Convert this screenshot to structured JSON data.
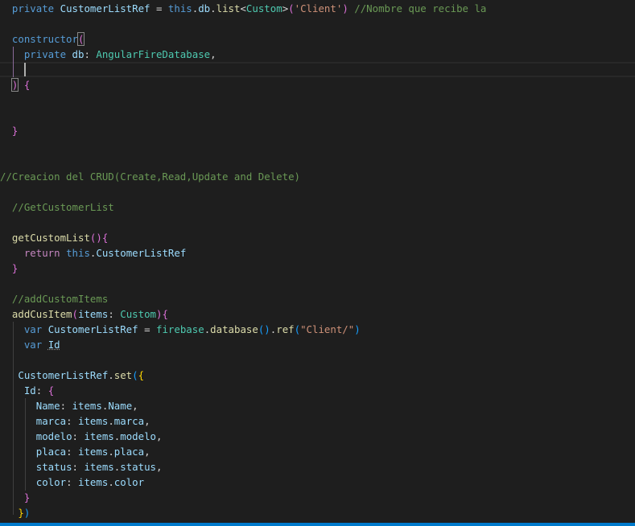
{
  "colors": {
    "kw": "#569cd6",
    "var": "#9cdcfe",
    "type": "#4ec9b0",
    "fn": "#dcdcaa",
    "str": "#ce9178",
    "cm": "#6a9955",
    "p": "#d4d4d4",
    "ctl": "#c586c0",
    "b1": "#ffd700",
    "b2": "#da70d6",
    "b3": "#179fff",
    "status_bar": "#007acc",
    "background": "#1e1e1e"
  },
  "lines": [
    [
      [
        "  ",
        "p"
      ],
      [
        "private",
        "kw"
      ],
      [
        " ",
        "p"
      ],
      [
        "CustomerListRef",
        "var"
      ],
      [
        " = ",
        "p"
      ],
      [
        "this",
        "kw"
      ],
      [
        ".",
        "p"
      ],
      [
        "db",
        "var"
      ],
      [
        ".",
        "p"
      ],
      [
        "list",
        "fn"
      ],
      [
        "<",
        "p"
      ],
      [
        "Custom",
        "type"
      ],
      [
        ">",
        "p"
      ],
      [
        "(",
        "b2"
      ],
      [
        "'Client'",
        "str"
      ],
      [
        ")",
        "b2"
      ],
      [
        " ",
        "p"
      ],
      [
        "//Nombre que recibe la",
        "cm"
      ]
    ],
    [],
    [
      [
        "  ",
        "p"
      ],
      [
        "constructor",
        "kw"
      ],
      [
        "(",
        "b2"
      ]
    ],
    [
      [
        "    ",
        "p"
      ],
      [
        "private",
        "kw"
      ],
      [
        " ",
        "p"
      ],
      [
        "db",
        "var"
      ],
      [
        ": ",
        "p"
      ],
      [
        "AngularFireDatabase",
        "type"
      ],
      [
        ",",
        "p"
      ]
    ],
    [],
    [
      [
        "  ",
        "p"
      ],
      [
        ")",
        "b2"
      ],
      [
        " ",
        "p"
      ],
      [
        "{",
        "b2"
      ]
    ],
    [],
    [],
    [
      [
        "  ",
        "p"
      ],
      [
        "}",
        "b2"
      ]
    ],
    [],
    [],
    [
      [
        "//Creacion del CRUD(Create,Read,Update and Delete)",
        "cm"
      ]
    ],
    [],
    [
      [
        "  ",
        "p"
      ],
      [
        "//GetCustomerList",
        "cm"
      ]
    ],
    [],
    [
      [
        "  ",
        "p"
      ],
      [
        "getCustomList",
        "fn"
      ],
      [
        "()",
        "b2"
      ],
      [
        "{",
        "b2"
      ]
    ],
    [
      [
        "    ",
        "p"
      ],
      [
        "return",
        "ctl"
      ],
      [
        " ",
        "p"
      ],
      [
        "this",
        "kw"
      ],
      [
        ".",
        "p"
      ],
      [
        "CustomerListRef",
        "var"
      ]
    ],
    [
      [
        "  ",
        "p"
      ],
      [
        "}",
        "b2"
      ]
    ],
    [],
    [
      [
        "  ",
        "p"
      ],
      [
        "//addCustomItems",
        "cm"
      ]
    ],
    [
      [
        "  ",
        "p"
      ],
      [
        "addCusItem",
        "fn"
      ],
      [
        "(",
        "b2"
      ],
      [
        "items",
        "var"
      ],
      [
        ": ",
        "p"
      ],
      [
        "Custom",
        "type"
      ],
      [
        ")",
        "b2"
      ],
      [
        "{",
        "b2"
      ]
    ],
    [
      [
        "    ",
        "p"
      ],
      [
        "var",
        "kw"
      ],
      [
        " ",
        "p"
      ],
      [
        "CustomerListRef",
        "var"
      ],
      [
        " = ",
        "p"
      ],
      [
        "firebase",
        "type"
      ],
      [
        ".",
        "p"
      ],
      [
        "database",
        "fn"
      ],
      [
        "()",
        "b3"
      ],
      [
        ".",
        "p"
      ],
      [
        "ref",
        "fn"
      ],
      [
        "(",
        "b3"
      ],
      [
        "\"Client/\"",
        "str"
      ],
      [
        ")",
        "b3"
      ]
    ],
    [
      [
        "    ",
        "p"
      ],
      [
        "var",
        "kw"
      ],
      [
        " ",
        "p"
      ],
      [
        "Id",
        "var"
      ]
    ],
    [],
    [
      [
        "   ",
        "p"
      ],
      [
        "CustomerListRef",
        "var"
      ],
      [
        ".",
        "p"
      ],
      [
        "set",
        "fn"
      ],
      [
        "(",
        "b3"
      ],
      [
        "{",
        "b1"
      ]
    ],
    [
      [
        "    ",
        "p"
      ],
      [
        "Id",
        "var"
      ],
      [
        ": ",
        "p"
      ],
      [
        "{",
        "b2"
      ]
    ],
    [
      [
        "      ",
        "p"
      ],
      [
        "Name",
        "var"
      ],
      [
        ": ",
        "p"
      ],
      [
        "items",
        "var"
      ],
      [
        ".",
        "p"
      ],
      [
        "Name",
        "var"
      ],
      [
        ",",
        "p"
      ]
    ],
    [
      [
        "      ",
        "p"
      ],
      [
        "marca",
        "var"
      ],
      [
        ": ",
        "p"
      ],
      [
        "items",
        "var"
      ],
      [
        ".",
        "p"
      ],
      [
        "marca",
        "var"
      ],
      [
        ",",
        "p"
      ]
    ],
    [
      [
        "      ",
        "p"
      ],
      [
        "modelo",
        "var"
      ],
      [
        ": ",
        "p"
      ],
      [
        "items",
        "var"
      ],
      [
        ".",
        "p"
      ],
      [
        "modelo",
        "var"
      ],
      [
        ",",
        "p"
      ]
    ],
    [
      [
        "      ",
        "p"
      ],
      [
        "placa",
        "var"
      ],
      [
        ": ",
        "p"
      ],
      [
        "items",
        "var"
      ],
      [
        ".",
        "p"
      ],
      [
        "placa",
        "var"
      ],
      [
        ",",
        "p"
      ]
    ],
    [
      [
        "      ",
        "p"
      ],
      [
        "status",
        "var"
      ],
      [
        ": ",
        "p"
      ],
      [
        "items",
        "var"
      ],
      [
        ".",
        "p"
      ],
      [
        "status",
        "var"
      ],
      [
        ",",
        "p"
      ]
    ],
    [
      [
        "      ",
        "p"
      ],
      [
        "color",
        "var"
      ],
      [
        ": ",
        "p"
      ],
      [
        "items",
        "var"
      ],
      [
        ".",
        "p"
      ],
      [
        "color",
        "var"
      ]
    ],
    [
      [
        "    ",
        "p"
      ],
      [
        "}",
        "b2"
      ]
    ],
    [
      [
        "   ",
        "p"
      ],
      [
        "}",
        "b1"
      ],
      [
        ")",
        "b3"
      ]
    ]
  ]
}
